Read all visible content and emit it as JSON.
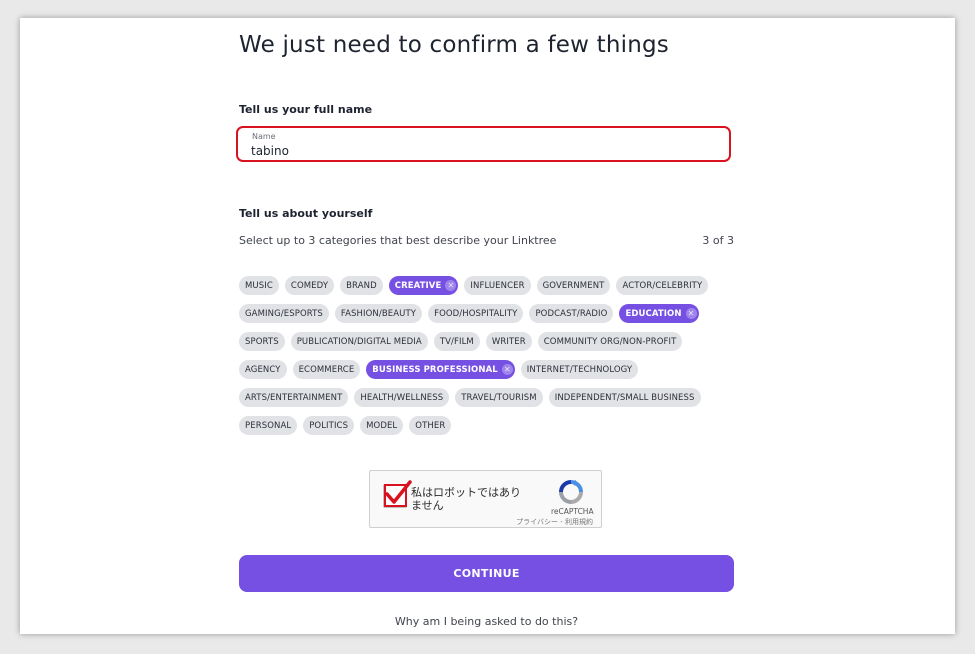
{
  "page": {
    "title": "We just need to confirm a few things"
  },
  "name_section": {
    "label": "Tell us your full name",
    "field_label": "Name",
    "value": "tabino"
  },
  "about_section": {
    "label": "Tell us about yourself",
    "helper": "Select up to 3 categories that best describe your Linktree",
    "count": "3 of 3"
  },
  "category_rows": [
    [
      {
        "label": "MUSIC",
        "selected": false
      },
      {
        "label": "COMEDY",
        "selected": false
      },
      {
        "label": "BRAND",
        "selected": false
      },
      {
        "label": "CREATIVE",
        "selected": true
      },
      {
        "label": "INFLUENCER",
        "selected": false
      },
      {
        "label": "GOVERNMENT",
        "selected": false
      },
      {
        "label": "ACTOR/CELEBRITY",
        "selected": false
      }
    ],
    [
      {
        "label": "GAMING/ESPORTS",
        "selected": false
      },
      {
        "label": "FASHION/BEAUTY",
        "selected": false
      },
      {
        "label": "FOOD/HOSPITALITY",
        "selected": false
      },
      {
        "label": "PODCAST/RADIO",
        "selected": false
      },
      {
        "label": "EDUCATION",
        "selected": true
      }
    ],
    [
      {
        "label": "SPORTS",
        "selected": false
      },
      {
        "label": "PUBLICATION/DIGITAL MEDIA",
        "selected": false
      },
      {
        "label": "TV/FILM",
        "selected": false
      },
      {
        "label": "WRITER",
        "selected": false
      },
      {
        "label": "COMMUNITY ORG/NON-PROFIT",
        "selected": false
      }
    ],
    [
      {
        "label": "AGENCY",
        "selected": false
      },
      {
        "label": "ECOMMERCE",
        "selected": false
      },
      {
        "label": "BUSINESS PROFESSIONAL",
        "selected": true
      },
      {
        "label": "INTERNET/TECHNOLOGY",
        "selected": false
      }
    ],
    [
      {
        "label": "ARTS/ENTERTAINMENT",
        "selected": false
      },
      {
        "label": "HEALTH/WELLNESS",
        "selected": false
      },
      {
        "label": "TRAVEL/TOURISM",
        "selected": false
      },
      {
        "label": "INDEPENDENT/SMALL BUSINESS",
        "selected": false
      }
    ],
    [
      {
        "label": "PERSONAL",
        "selected": false
      },
      {
        "label": "POLITICS",
        "selected": false
      },
      {
        "label": "MODEL",
        "selected": false
      },
      {
        "label": "OTHER",
        "selected": false
      }
    ]
  ],
  "captcha": {
    "text": "私はロボットではありません",
    "brand": "reCAPTCHA",
    "links": "プライバシー - 利用規約",
    "checked": true,
    "icon": "recaptcha-logo-icon"
  },
  "continue_label": "CONTINUE",
  "why_link": "Why am I being asked to do this?",
  "colors": {
    "accent": "#7650e2",
    "chip_bg": "#e0e2e6",
    "highlight_red": "#d8121f"
  }
}
